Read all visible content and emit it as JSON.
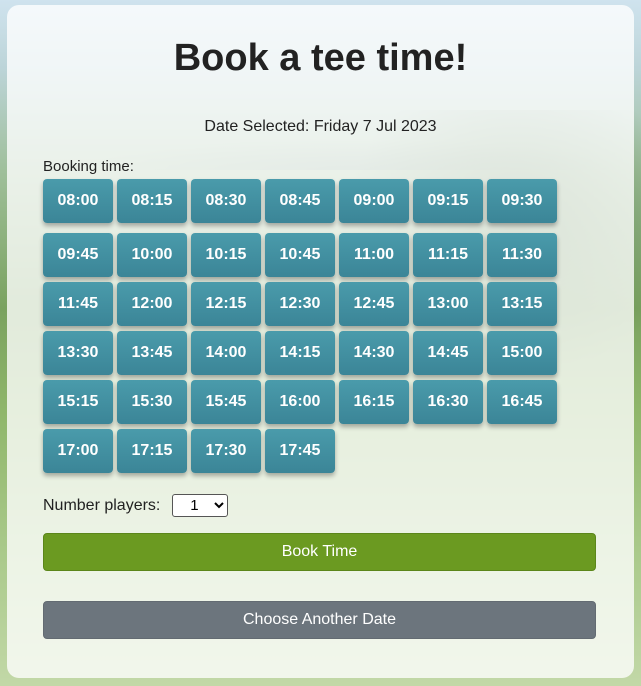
{
  "page": {
    "title": "Book a tee time!",
    "date_selected": "Date Selected: Friday 7 Jul 2023",
    "booking_time_label": "Booking time:",
    "times": [
      "08:00",
      "08:15",
      "08:30",
      "08:45",
      "09:00",
      "09:15",
      "09:30",
      "09:45",
      "10:00",
      "10:15",
      "10:45",
      "11:00",
      "11:15",
      "11:30",
      "11:45",
      "12:00",
      "12:15",
      "12:30",
      "12:45",
      "13:00",
      "13:15",
      "13:30",
      "13:45",
      "14:00",
      "14:15",
      "14:30",
      "14:45",
      "15:00",
      "15:15",
      "15:30",
      "15:45",
      "16:00",
      "16:15",
      "16:30",
      "16:45",
      "17:00",
      "17:15",
      "17:30",
      "17:45"
    ],
    "players_label": "Number players:",
    "players_selected": "1",
    "book_button": "Book Time",
    "other_date_button": "Choose Another Date"
  },
  "colors": {
    "slot": "#3b8597",
    "book": "#6b9a21",
    "secondary": "#6c757d"
  }
}
